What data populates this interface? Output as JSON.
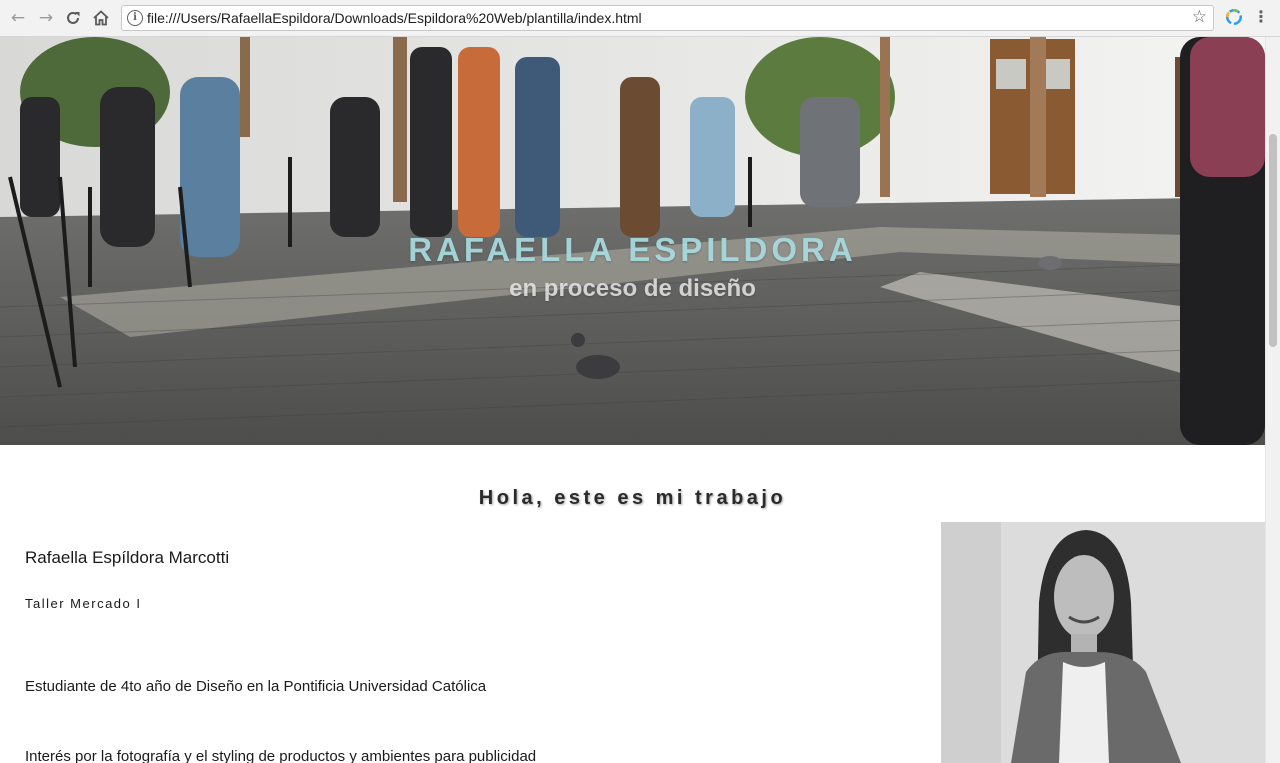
{
  "browser": {
    "url": "file:///Users/RafaellaEspildora/Downloads/Espildora%20Web/plantilla/index.html",
    "icons": [
      "back-icon",
      "forward-icon",
      "reload-icon",
      "home-icon",
      "info-icon",
      "star-icon",
      "extension-icon",
      "menu-icon"
    ]
  },
  "hero": {
    "title": "RAFAELLA ESPILDORA",
    "subtitle": "en proceso de diseño",
    "title_color": "#a8dbe0"
  },
  "content": {
    "heading": "Hola, este es mi trabajo",
    "name": "Rafaella Espíldora Marcotti",
    "course": "Taller Mercado I",
    "paragraph_1": "Estudiante de 4to año de Diseño en la Pontificia Universidad Católica",
    "paragraph_2": "Interés por la fotografía y el styling de productos y ambientes para publicidad"
  }
}
